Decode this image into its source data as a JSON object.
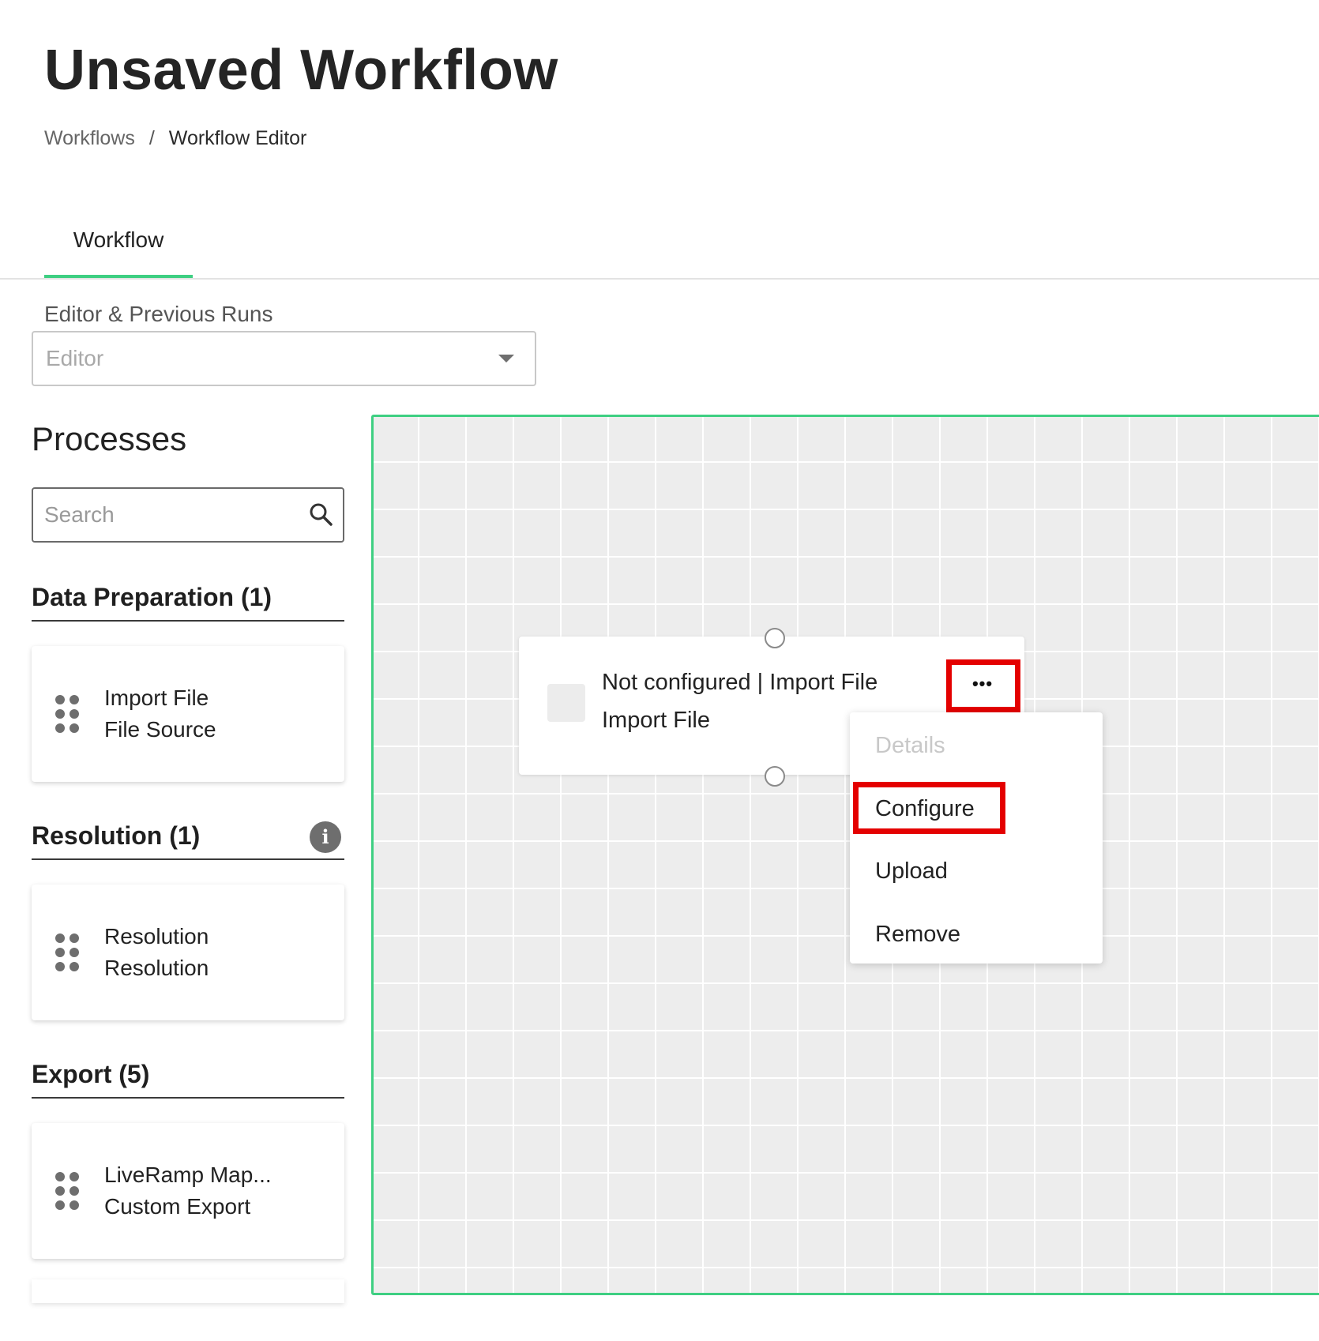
{
  "header": {
    "title": "Unsaved Workflow",
    "breadcrumb": {
      "parent": "Workflows",
      "separator": "/",
      "current": "Workflow Editor"
    }
  },
  "tabs": [
    {
      "label": "Workflow",
      "active": true
    }
  ],
  "runs_select": {
    "label": "Editor & Previous Runs",
    "value": "Editor"
  },
  "processes": {
    "title": "Processes",
    "search_placeholder": "Search",
    "sections": [
      {
        "title": "Data Preparation (1)",
        "info": false,
        "items": [
          {
            "name": "Import File",
            "type": "File Source"
          }
        ]
      },
      {
        "title": "Resolution (1)",
        "info": true,
        "items": [
          {
            "name": "Resolution",
            "type": "Resolution"
          }
        ]
      },
      {
        "title": "Export (5)",
        "info": false,
        "items": [
          {
            "name": "LiveRamp Map...",
            "type": "Custom Export"
          }
        ]
      }
    ]
  },
  "canvas": {
    "node": {
      "title": "Not configured | Import File",
      "subtitle": "Import File",
      "more_label": "•••"
    },
    "context_menu": {
      "items": [
        {
          "label": "Details",
          "disabled": true
        },
        {
          "label": "Configure",
          "disabled": false,
          "highlighted": true
        },
        {
          "label": "Upload",
          "disabled": false
        },
        {
          "label": "Remove",
          "disabled": false
        }
      ]
    }
  },
  "colors": {
    "accent": "#3ecf82",
    "highlight": "#e40000",
    "canvas_bg": "#ededed"
  },
  "icons": {
    "search": "search-icon",
    "info": "info-icon",
    "drag": "drag-handle-icon",
    "more": "more-horizontal-icon"
  }
}
